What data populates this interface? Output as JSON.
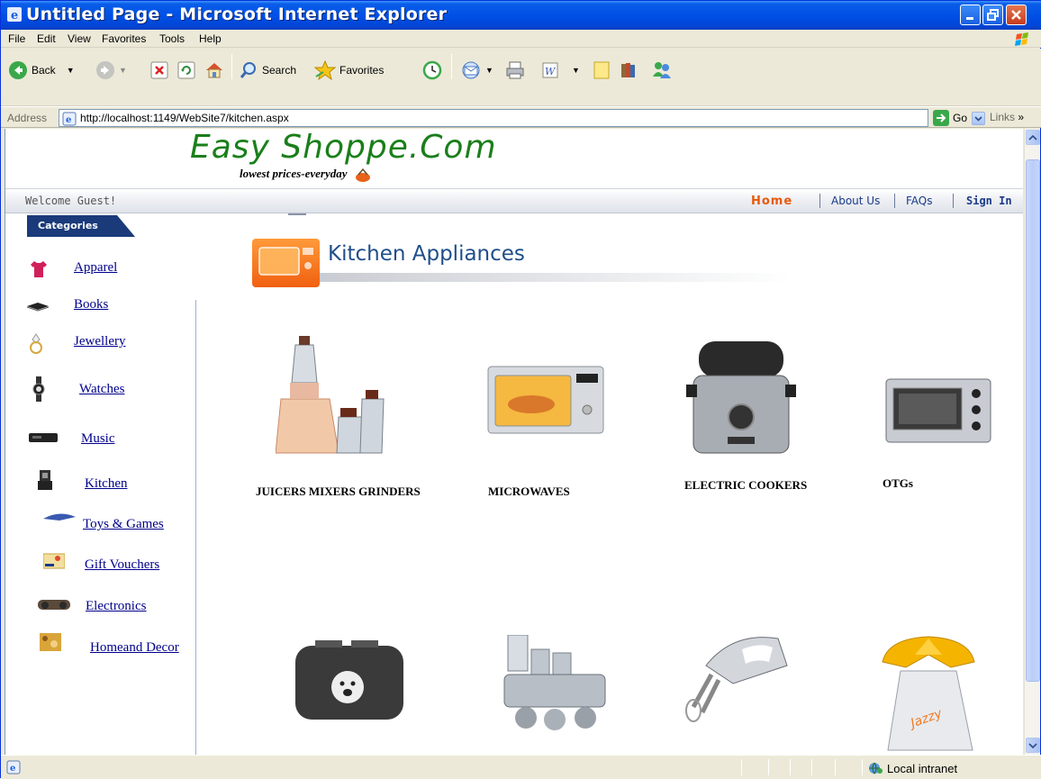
{
  "window": {
    "title": "Untitled Page - Microsoft Internet Explorer"
  },
  "menu": {
    "items": [
      "File",
      "Edit",
      "View",
      "Favorites",
      "Tools",
      "Help"
    ]
  },
  "toolbar": {
    "back": "Back",
    "search": "Search",
    "favorites": "Favorites"
  },
  "address": {
    "label": "Address",
    "url": "http://localhost:1149/WebSite7/kitchen.aspx",
    "go": "Go",
    "links": "Links"
  },
  "site": {
    "logo": "Easy Shoppe.Com",
    "tagline": "lowest prices-everyday",
    "welcome": "Welcome Guest!",
    "nav": {
      "home": "Home",
      "about": "About Us",
      "faqs": "FAQs",
      "signin": "Sign In"
    },
    "categories_title": "Categories",
    "categories": [
      {
        "label": "Apparel",
        "icon": "tshirt-icon"
      },
      {
        "label": "Books",
        "icon": "book-icon"
      },
      {
        "label": "Jewellery",
        "icon": "ring-icon"
      },
      {
        "label": "Watches",
        "icon": "watch-icon"
      },
      {
        "label": "Music",
        "icon": "music-player-icon"
      },
      {
        "label": "Kitchen",
        "icon": "mixer-icon"
      },
      {
        "label": "Toys & Games",
        "icon": "toy-plane-icon"
      },
      {
        "label": "Gift Vouchers",
        "icon": "gift-voucher-icon"
      },
      {
        "label": "Electronics",
        "icon": "boombox-icon"
      },
      {
        "label": "Homeand Decor",
        "icon": "decor-icon"
      }
    ],
    "section_title": "Kitchen Appliances",
    "products_row1": [
      {
        "label": "JUICERS MIXERS GRINDERS",
        "icon": "mixer-grinder-image"
      },
      {
        "label": "MICROWAVES",
        "icon": "microwave-image"
      },
      {
        "label": "ELECTRIC COOKERS",
        "icon": "electric-cooker-image"
      },
      {
        "label": "OTGs",
        "icon": "otg-oven-image"
      }
    ],
    "products_row2": [
      {
        "icon": "toaster-image"
      },
      {
        "icon": "food-processor-image"
      },
      {
        "icon": "hand-mixer-image"
      },
      {
        "icon": "citrus-juicer-image"
      }
    ]
  },
  "status": {
    "zone": "Local intranet"
  },
  "colors": {
    "logo_green": "#1a7f1a",
    "nav_home_orange": "#e8590c",
    "link_blue": "#00008b",
    "section_title_blue": "#1f4e8a"
  }
}
